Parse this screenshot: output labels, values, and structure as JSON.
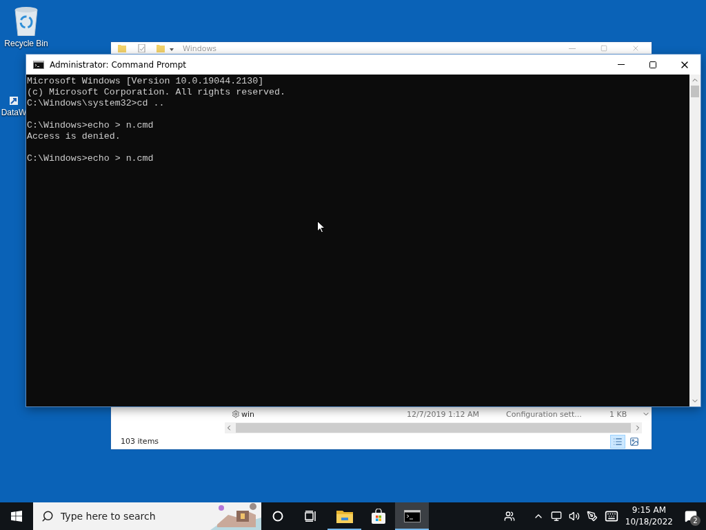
{
  "desktop_icons": [
    {
      "label": "Recycle Bin",
      "kind": "recycle"
    },
    {
      "label": "DataW",
      "kind": "shortcut"
    }
  ],
  "explorer": {
    "title": "Windows",
    "rows": [
      {
        "name": "win",
        "date": "12/7/2019 1:12 AM",
        "type": "Configuration sett...",
        "size": "1 KB"
      }
    ],
    "status": "103 items",
    "views": [
      {
        "kind": "details",
        "selected": true
      },
      {
        "kind": "icons",
        "selected": false
      }
    ]
  },
  "console": {
    "title": "Administrator: Command Prompt",
    "blocks": [
      [
        "Microsoft Windows [Version 10.0.19044.2130]",
        "(c) Microsoft Corporation. All rights reserved.",
        "C:\\Windows\\system32>cd .."
      ],
      [
        "C:\\Windows>echo > n.cmd",
        "Access is denied."
      ],
      [
        "C:\\Windows>echo > n.cmd"
      ]
    ]
  },
  "taskbar": {
    "search_placeholder": "Type here to search",
    "apps": [
      {
        "kind": "explorer",
        "running": true,
        "selected": false
      },
      {
        "kind": "store",
        "running": false,
        "selected": false
      },
      {
        "kind": "cmd",
        "running": true,
        "selected": true
      }
    ],
    "time": "9:15 AM",
    "date": "10/18/2022",
    "notification_count": "2"
  }
}
